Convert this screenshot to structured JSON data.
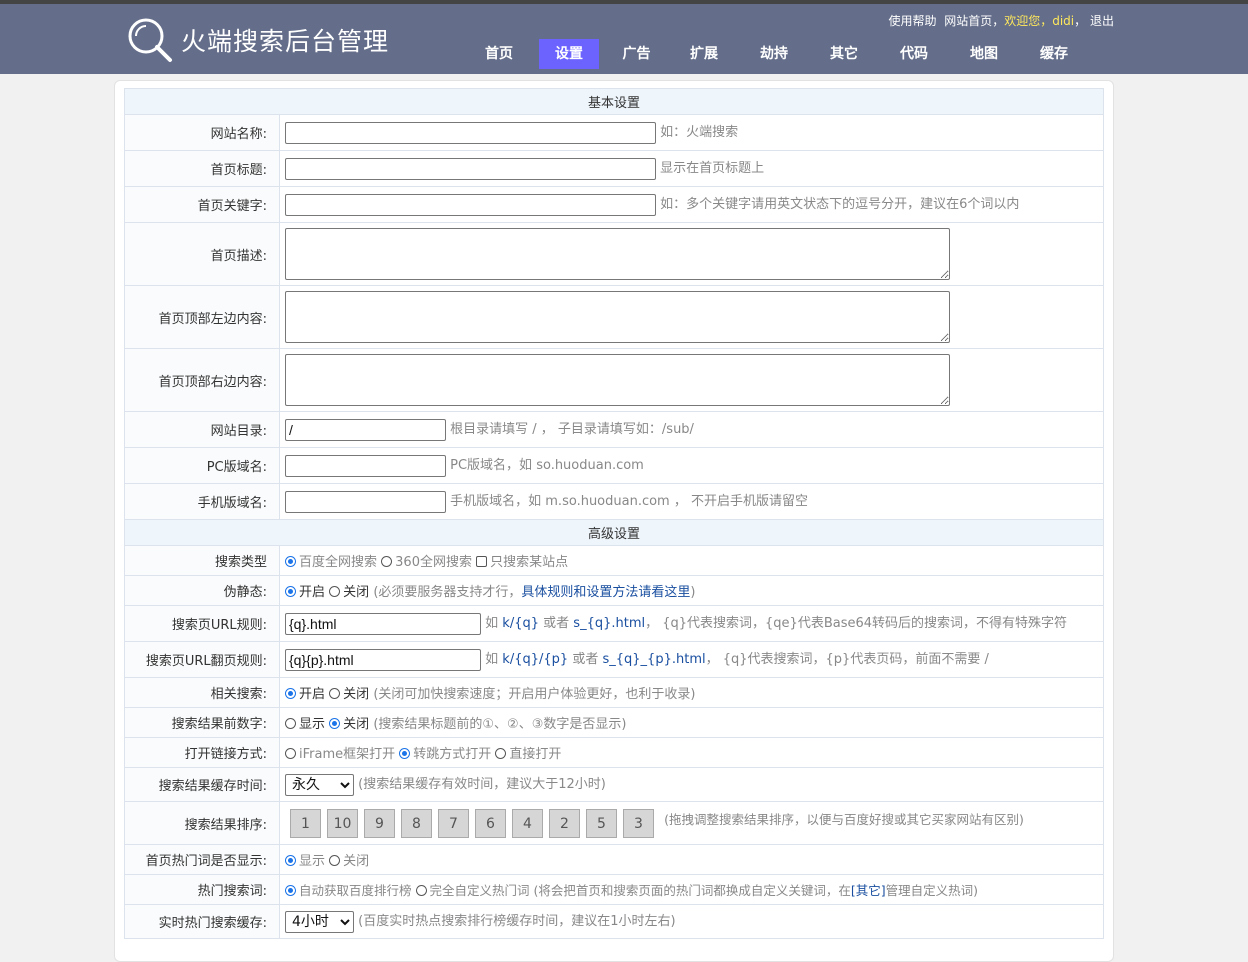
{
  "header": {
    "title": "火端搜索后台管理",
    "logo_icon": "magnifier-icon",
    "links": {
      "help": "使用帮助",
      "home": "网站首页，",
      "welcome": "欢迎您，",
      "user": "didi",
      "sep": "，",
      "logout": "退出"
    },
    "nav": [
      "首页",
      "设置",
      "广告",
      "扩展",
      "劫持",
      "其它",
      "代码",
      "地图",
      "缓存"
    ],
    "nav_active": "设置"
  },
  "basic": {
    "section": "基本设置",
    "site_name": {
      "label": "网站名称:",
      "value": "",
      "hint": "如：火端搜索"
    },
    "home_title": {
      "label": "首页标题:",
      "value": "",
      "hint": "显示在首页标题上"
    },
    "home_keywords": {
      "label": "首页关键字:",
      "value": "",
      "hint": "如：多个关键字请用英文状态下的逗号分开，建议在6个词以内"
    },
    "home_desc": {
      "label": "首页描述:"
    },
    "top_left": {
      "label": "首页顶部左边内容:"
    },
    "top_right": {
      "label": "首页顶部右边内容:"
    },
    "site_dir": {
      "label": "网站目录:",
      "value": "/",
      "hint": "根目录请填写 / ， 子目录请填写如：/sub/"
    },
    "pc_domain": {
      "label": "PC版域名:",
      "value": "",
      "hint": "PC版域名，如 so.huoduan.com"
    },
    "mobile_domain": {
      "label": "手机版域名:",
      "value": "",
      "hint": "手机版域名，如 m.so.huoduan.com ， 不开启手机版请留空"
    }
  },
  "advanced": {
    "section": "高级设置",
    "search_type": {
      "label": "搜索类型",
      "opt1": "百度全网搜索",
      "opt2": "360全网搜索",
      "opt3": "只搜索某站点"
    },
    "rewrite": {
      "label": "伪静态:",
      "on": "开启",
      "off": "关闭",
      "note1": "(必须要服务器支持才行，",
      "link": "具体规则和设置方法请看这里",
      "note2": ")"
    },
    "url_rule": {
      "label": "搜索页URL规则:",
      "value": "{q}.html",
      "ru": "如",
      "ex1": "k/{q}",
      "or": "或者",
      "ex2": "s_{q}.html",
      "note": "， {q}代表搜索词，{qe}代表Base64转码后的搜索词，不得有特殊字符"
    },
    "page_rule": {
      "label": "搜索页URL翻页规则:",
      "value": "{q}{p}.html",
      "ru": "如",
      "ex1": "k/{q}/{p}",
      "or": "或者",
      "ex2": "s_{q}_{p}.html",
      "note": "， {q}代表搜索词，{p}代表页码，前面不需要 /"
    },
    "related": {
      "label": "相关搜索:",
      "on": "开启",
      "off": "关闭",
      "note": "(关闭可加快搜索速度；开启用户体验更好，也利于收录)"
    },
    "number": {
      "label": "搜索结果前数字:",
      "on": "显示",
      "off": "关闭",
      "note": "(搜索结果标题前的①、②、③数字是否显示)"
    },
    "open_mode": {
      "label": "打开链接方式:",
      "opt1": "iFrame框架打开",
      "opt2": "转跳方式打开",
      "opt3": "直接打开"
    },
    "cache_time": {
      "label": "搜索结果缓存时间:",
      "value": "永久",
      "note": "(搜索结果缓存有效时间，建议大于12小时)"
    },
    "sort": {
      "label": "搜索结果排序:",
      "items": [
        "1",
        "10",
        "9",
        "8",
        "7",
        "6",
        "4",
        "2",
        "5",
        "3"
      ],
      "note": "(拖拽调整搜索结果排序，以便与百度好搜或其它买家网站有区别)"
    },
    "hot_show": {
      "label": "首页热门词是否显示:",
      "on": "显示",
      "off": "关闭"
    },
    "hot_words": {
      "label": "热门搜索词:",
      "opt1": "自动获取百度排行榜",
      "opt2": "完全自定义热门词",
      "note1": "(将会把首页和搜索页面的热门词都换成自定义关键词，在",
      "link": "[其它]",
      "note2": "管理自定义热词)"
    },
    "realtime_cache": {
      "label": "实时热门搜索缓存:",
      "value": "4小时",
      "note": "(百度实时热点搜索排行榜缓存时间，建议在1小时左右)"
    }
  }
}
